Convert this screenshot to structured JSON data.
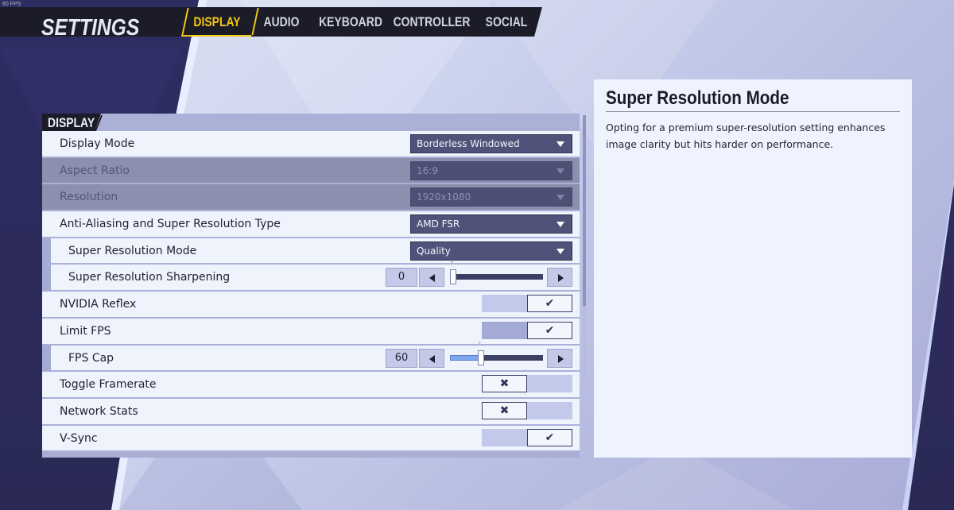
{
  "fps_counter": "60 FPS",
  "header": {
    "title": "SETTINGS",
    "tabs": [
      {
        "label": "DISPLAY",
        "active": true
      },
      {
        "label": "AUDIO",
        "active": false
      },
      {
        "label": "KEYBOARD",
        "active": false
      },
      {
        "label": "CONTROLLER",
        "active": false
      },
      {
        "label": "SOCIAL",
        "active": false
      }
    ],
    "accent_color": "#f4c712"
  },
  "section": {
    "title": "DISPLAY",
    "rows": [
      {
        "label": "Display Mode",
        "type": "dropdown",
        "value": "Borderless Windowed",
        "disabled": false,
        "sub": false
      },
      {
        "label": "Aspect Ratio",
        "type": "dropdown",
        "value": "16:9",
        "disabled": true,
        "sub": false
      },
      {
        "label": "Resolution",
        "type": "dropdown",
        "value": "1920x1080",
        "disabled": true,
        "sub": false
      },
      {
        "label": "Anti-Aliasing and Super Resolution Type",
        "type": "dropdown",
        "value": "AMD FSR",
        "disabled": false,
        "sub": false
      },
      {
        "label": "Super Resolution Mode",
        "type": "dropdown",
        "value": "Quality",
        "disabled": false,
        "sub": true
      },
      {
        "label": "Super Resolution Sharpening",
        "type": "slider",
        "value": "0",
        "fraction": 0.0,
        "sub": true
      },
      {
        "label": "NVIDIA Reflex",
        "type": "toggle",
        "checked": true,
        "sub": false
      },
      {
        "label": "Limit FPS",
        "type": "toggle",
        "checked": true,
        "sub": false
      },
      {
        "label": "FPS Cap",
        "type": "slider",
        "value": "60",
        "fraction": 0.33,
        "sub": true
      },
      {
        "label": "Toggle Framerate",
        "type": "toggle",
        "checked": false,
        "sub": false
      },
      {
        "label": "Network Stats",
        "type": "toggle",
        "checked": false,
        "sub": false
      },
      {
        "label": "V-Sync",
        "type": "toggle",
        "checked": true,
        "sub": false
      }
    ]
  },
  "icons": {
    "check": "✔",
    "cross": "✖"
  },
  "description": {
    "title": "Super Resolution Mode",
    "body": "Opting for a premium super-resolution setting enhances image clarity but hits harder on performance."
  }
}
